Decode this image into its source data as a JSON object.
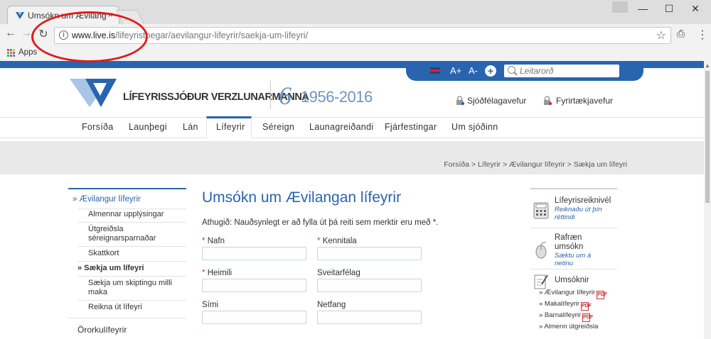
{
  "browser": {
    "tab_title": "Umsókn um Ævilangan l",
    "tab_close": "×",
    "url_host": "www.live.is",
    "url_path": "/lifeyristhegar/aevilangur-lifeyrir/saekja-um-lifeyri/",
    "bookmarks_apps": "Apps",
    "win_minimize": "—",
    "win_maximize": "☐",
    "win_close": "✕"
  },
  "header": {
    "lang_flag": "english-flag",
    "font_larger": "A+",
    "font_smaller": "A-",
    "add_icon": "+",
    "search_placeholder": "Leitarorð",
    "logo_text": "LÍFEYRISSJÓÐUR VERZLUNARMANNA",
    "anniversary_mark": "6",
    "anniversary_years": "1956-2016",
    "portal_members": "Sjóðfélagavefur",
    "portal_companies": "Fyrirtækjavefur"
  },
  "nav": {
    "items": [
      "Forsíða",
      "Launþegi",
      "Lán",
      "Lífeyrir",
      "Séreign",
      "Launagreiðandi",
      "Fjárfestingar",
      "Um sjóðinn"
    ],
    "active": "Lífeyrir"
  },
  "breadcrumb": "Forsíða > Lífeyrir > Ævilangur lífeyrir > Sækja um lífeyri",
  "leftmenu": {
    "section": "» Ævilangur lífeyrir",
    "items": [
      "Almennar upplýsingar",
      "Útgreiðsla séreignarsparnaðar",
      "Skattkort",
      "» Sækja um lífeyri",
      "Sækja um skiptingu milli maka",
      "Reikna út lífeyri"
    ],
    "next_section": "Örorkulífeyrir"
  },
  "main": {
    "title": "Umsókn um Ævilangan lífeyrir",
    "note": "Athugið: Nauðsynlegt er að fylla út þá reiti sem merktir eru með *.",
    "fields": {
      "nafn": "Nafn",
      "kennitala": "Kennitala",
      "heimili": "Heimili",
      "sveitarfelag": "Sveitarfélag",
      "simi": "Sími",
      "netfang": "Netfang"
    },
    "required_mark": "*"
  },
  "rightbar": {
    "calc_title": "Lífeyrisreiknivél",
    "calc_sub": "Reiknaðu út þín réttindi",
    "online_title": "Rafræn umsókn",
    "online_sub": "Sæktu um á netinu",
    "forms_title": "Umsóknir",
    "links": [
      "» Ævilangur lífeyrir",
      "» Makalífeyrir",
      "» Barnalífeyrir",
      "» Almenn útgreiðsla"
    ],
    "pdf_label": "PDF"
  },
  "colors": {
    "brand_blue": "#2964ae",
    "annotation_red": "#e01b1b"
  }
}
